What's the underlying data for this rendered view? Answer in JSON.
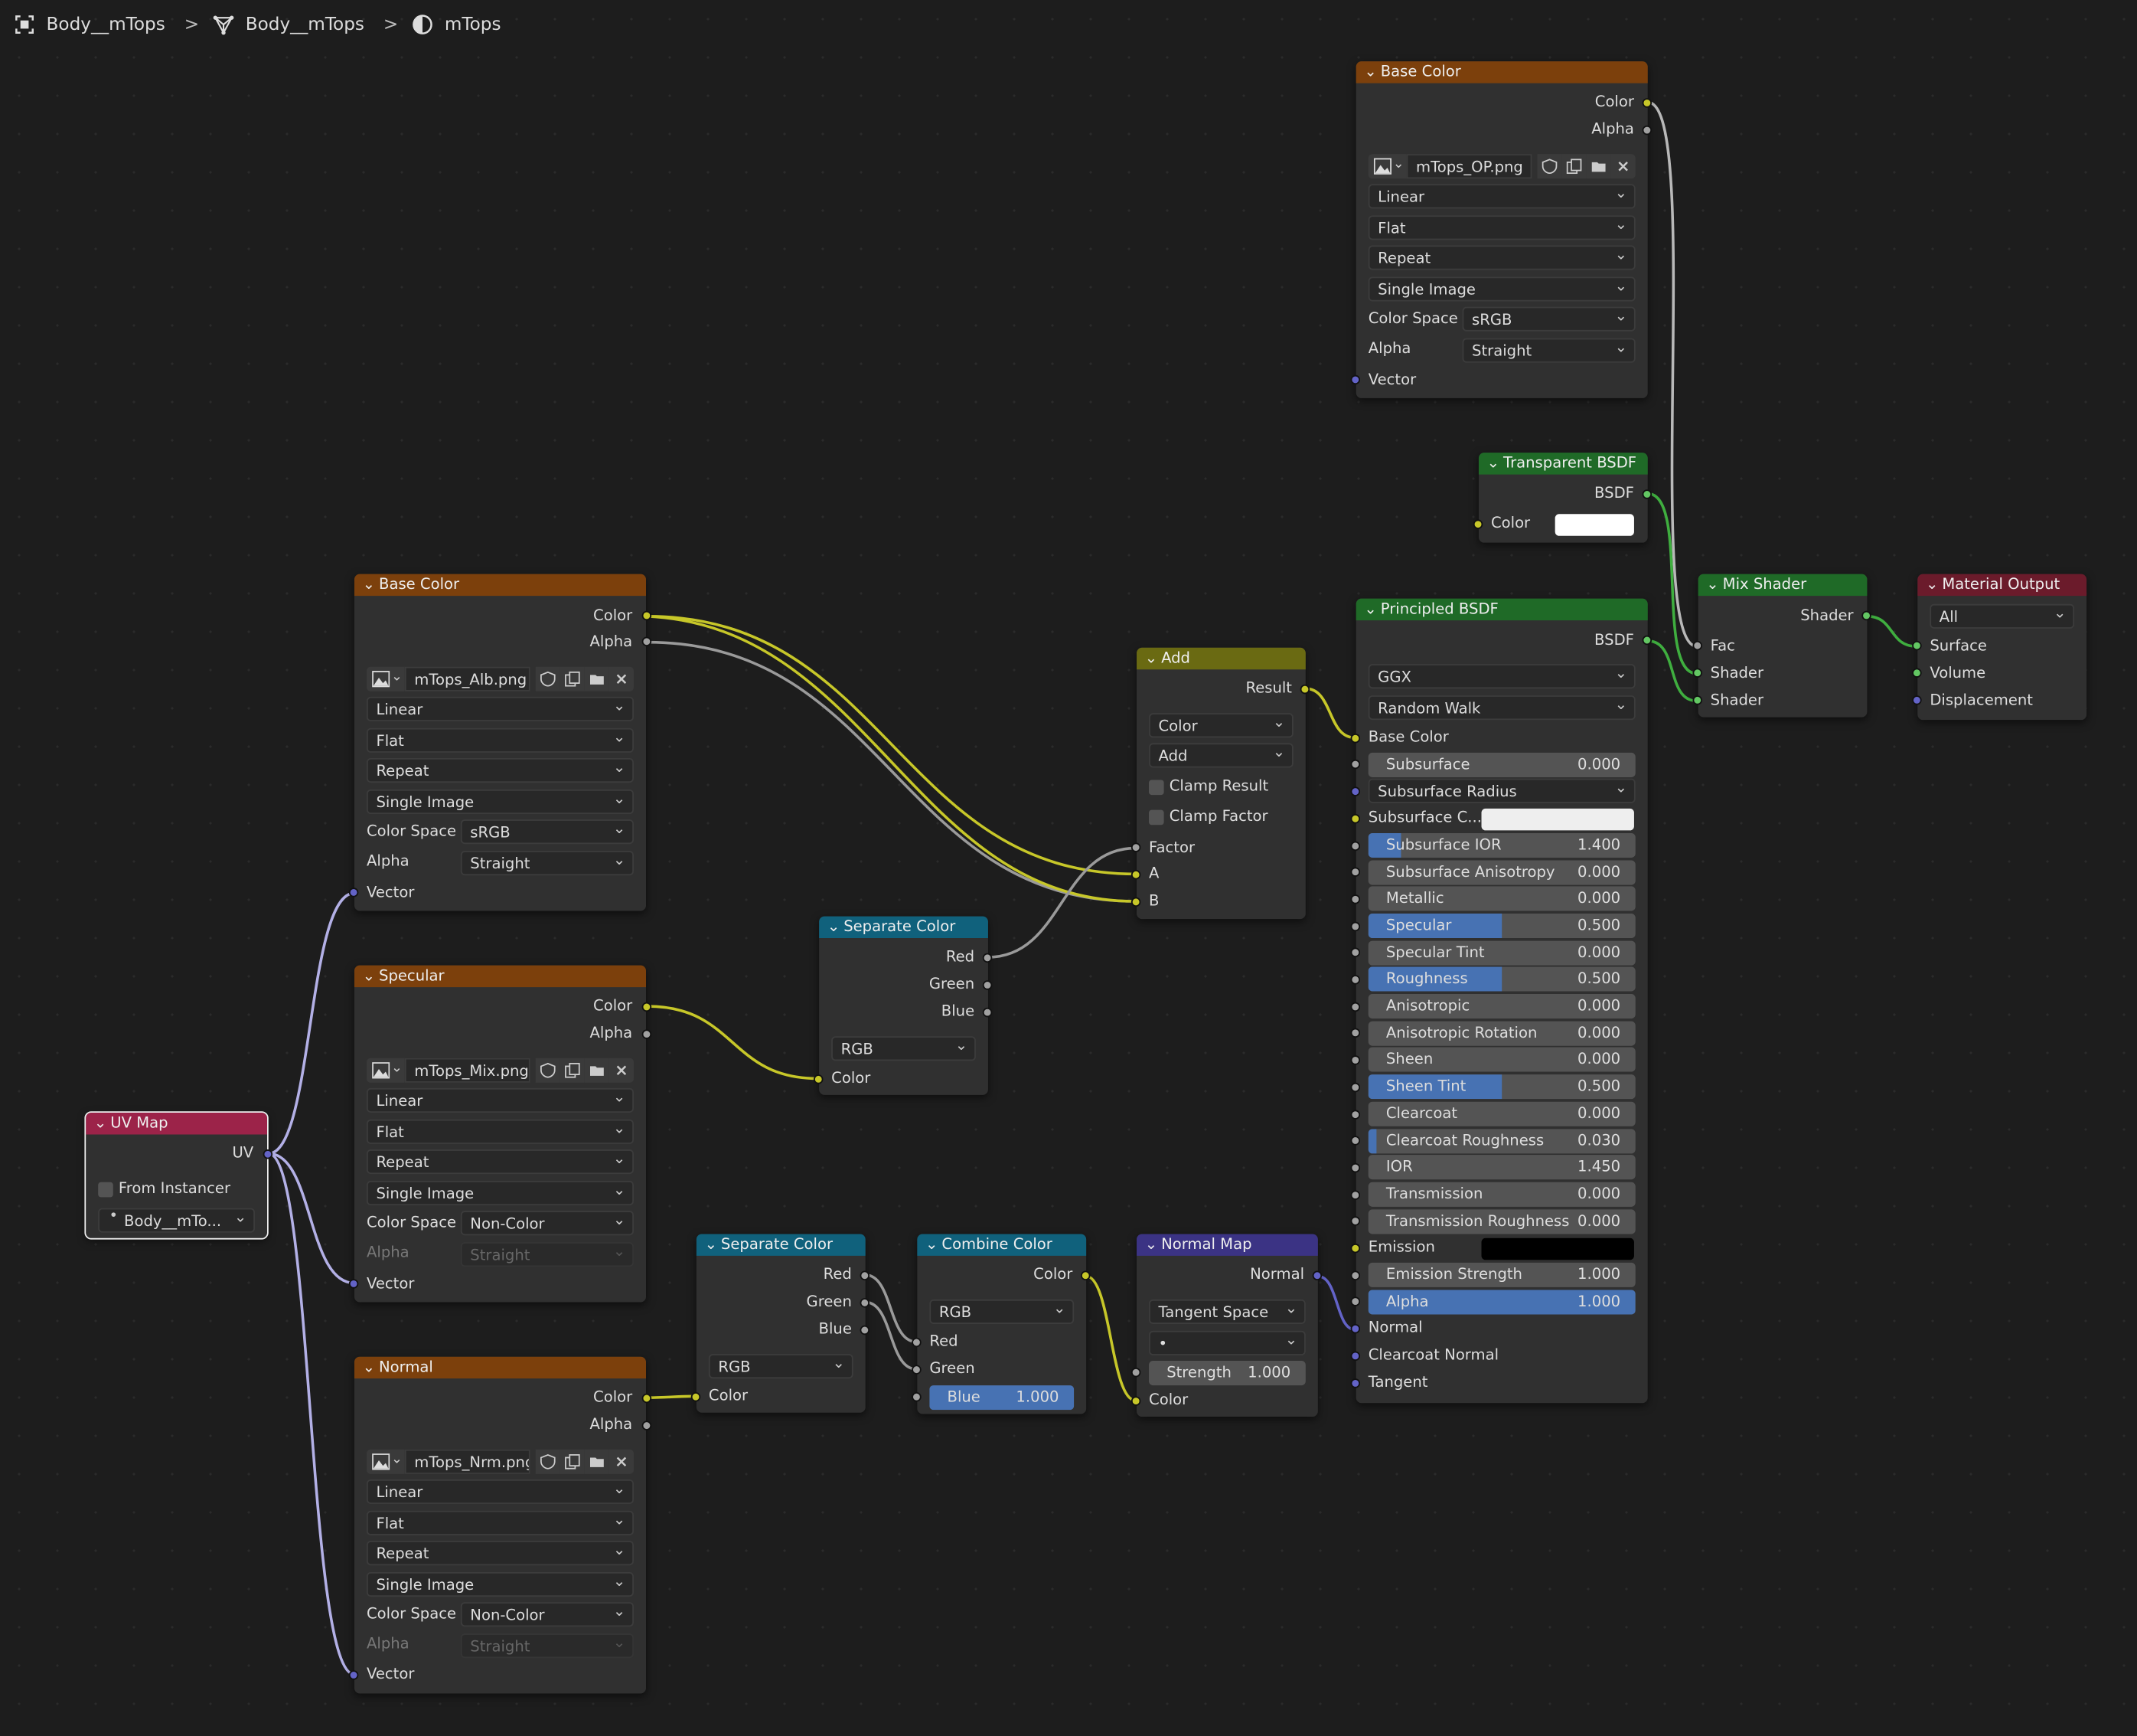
{
  "breadcrumb": {
    "items": [
      {
        "label": "Body__mTops",
        "icon": "object-icon"
      },
      {
        "label": "Body__mTops",
        "icon": "mesh-icon"
      },
      {
        "label": "mTops",
        "icon": "material-icon"
      }
    ],
    "separator": ">"
  },
  "colors": {
    "accent": "#4772b3",
    "texture_header": "#7c400c",
    "shader_header": "#1f6a27",
    "converter_header": "#10617c",
    "vector_header": "#3b3384",
    "math_header": "#6a6a12",
    "output_header": "#6b1b2b",
    "uv_header": "#9c2349",
    "socket_color": "#c7c729",
    "socket_float": "#a1a1a1",
    "socket_vector": "#6363c7",
    "socket_shader": "#63c763"
  },
  "nodes": {
    "base_color_op": {
      "title": "Base Color",
      "out_color": "Color",
      "out_alpha": "Alpha",
      "image": "mTops_OP.png",
      "interpolation": "Linear",
      "projection": "Flat",
      "extension": "Repeat",
      "source": "Single Image",
      "color_space_label": "Color Space",
      "color_space": "sRGB",
      "alpha_label": "Alpha",
      "alpha": "Straight",
      "in_vector": "Vector"
    },
    "transparent": {
      "title": "Transparent BSDF",
      "out_bsdf": "BSDF",
      "in_color": "Color",
      "color_value": "#ffffff"
    },
    "base_color_alb": {
      "title": "Base Color",
      "out_color": "Color",
      "out_alpha": "Alpha",
      "image": "mTops_Alb.png",
      "interpolation": "Linear",
      "projection": "Flat",
      "extension": "Repeat",
      "source": "Single Image",
      "color_space_label": "Color Space",
      "color_space": "sRGB",
      "alpha_label": "Alpha",
      "alpha": "Straight",
      "in_vector": "Vector"
    },
    "specular": {
      "title": "Specular",
      "out_color": "Color",
      "out_alpha": "Alpha",
      "image": "mTops_Mix.png",
      "interpolation": "Linear",
      "projection": "Flat",
      "extension": "Repeat",
      "source": "Single Image",
      "color_space_label": "Color Space",
      "color_space": "Non-Color",
      "alpha_label": "Alpha",
      "alpha": "Straight",
      "in_vector": "Vector"
    },
    "normal_tex": {
      "title": "Normal",
      "out_color": "Color",
      "out_alpha": "Alpha",
      "image": "mTops_Nrm.png",
      "interpolation": "Linear",
      "projection": "Flat",
      "extension": "Repeat",
      "source": "Single Image",
      "color_space_label": "Color Space",
      "color_space": "Non-Color",
      "alpha_label": "Alpha",
      "alpha": "Straight",
      "in_vector": "Vector"
    },
    "uv_map": {
      "title": "UV Map",
      "out_uv": "UV",
      "from_instancer": "From Instancer",
      "map": "Body__mTo..."
    },
    "add": {
      "title": "Add",
      "out_result": "Result",
      "mode": "Color",
      "blend": "Add",
      "clamp_result": "Clamp Result",
      "clamp_factor": "Clamp Factor",
      "in_factor": "Factor",
      "in_a": "A",
      "in_b": "B"
    },
    "separate_top": {
      "title": "Separate Color",
      "out_red": "Red",
      "out_green": "Green",
      "out_blue": "Blue",
      "mode": "RGB",
      "in_color": "Color"
    },
    "separate_bottom": {
      "title": "Separate Color",
      "out_red": "Red",
      "out_green": "Green",
      "out_blue": "Blue",
      "mode": "RGB",
      "in_color": "Color"
    },
    "combine": {
      "title": "Combine Color",
      "out_color": "Color",
      "mode": "RGB",
      "in_red": "Red",
      "in_green": "Green",
      "blue_label": "Blue",
      "blue_value": "1.000",
      "blue_fill": 1.0
    },
    "normal_map": {
      "title": "Normal Map",
      "out_normal": "Normal",
      "space": "Tangent Space",
      "uv_field": "•",
      "strength_label": "Strength",
      "strength_value": "1.000",
      "in_color": "Color"
    },
    "principled": {
      "title": "Principled BSDF",
      "out_bsdf": "BSDF",
      "distribution": "GGX",
      "subsurface_method": "Random Walk",
      "base_color": "Base Color",
      "subsurface_radius": "Subsurface Radius",
      "subsurface_color_label": "Subsurface C...",
      "subsurface_color_value": "#eeeeee",
      "emission_label": "Emission",
      "emission_value": "#000000",
      "normal": "Normal",
      "clearcoat_normal": "Clearcoat Normal",
      "tangent": "Tangent",
      "fields": [
        {
          "label": "Subsurface",
          "value": "0.000",
          "fill": 0
        },
        {
          "label": "Subsurface IOR",
          "value": "1.400",
          "fill": 0.12
        },
        {
          "label": "Subsurface Anisotropy",
          "value": "0.000",
          "fill": 0
        },
        {
          "label": "Metallic",
          "value": "0.000",
          "fill": 0
        },
        {
          "label": "Specular",
          "value": "0.500",
          "fill": 0.5
        },
        {
          "label": "Specular Tint",
          "value": "0.000",
          "fill": 0
        },
        {
          "label": "Roughness",
          "value": "0.500",
          "fill": 0.5
        },
        {
          "label": "Anisotropic",
          "value": "0.000",
          "fill": 0
        },
        {
          "label": "Anisotropic Rotation",
          "value": "0.000",
          "fill": 0
        },
        {
          "label": "Sheen",
          "value": "0.000",
          "fill": 0
        },
        {
          "label": "Sheen Tint",
          "value": "0.500",
          "fill": 0.5
        },
        {
          "label": "Clearcoat",
          "value": "0.000",
          "fill": 0
        },
        {
          "label": "Clearcoat Roughness",
          "value": "0.030",
          "fill": 0.03
        },
        {
          "label": "IOR",
          "value": "1.450",
          "fill": 0
        },
        {
          "label": "Transmission",
          "value": "0.000",
          "fill": 0
        },
        {
          "label": "Transmission Roughness",
          "value": "0.000",
          "fill": 0
        },
        {
          "label": "Emission Strength",
          "value": "1.000",
          "fill": 0
        },
        {
          "label": "Alpha",
          "value": "1.000",
          "fill": 1.0
        }
      ]
    },
    "mix": {
      "title": "Mix Shader",
      "out_shader": "Shader",
      "in_fac": "Fac",
      "in_shader1": "Shader",
      "in_shader2": "Shader"
    },
    "output": {
      "title": "Material Output",
      "target": "All",
      "in_surface": "Surface",
      "in_volume": "Volume",
      "in_displacement": "Displacement"
    }
  }
}
